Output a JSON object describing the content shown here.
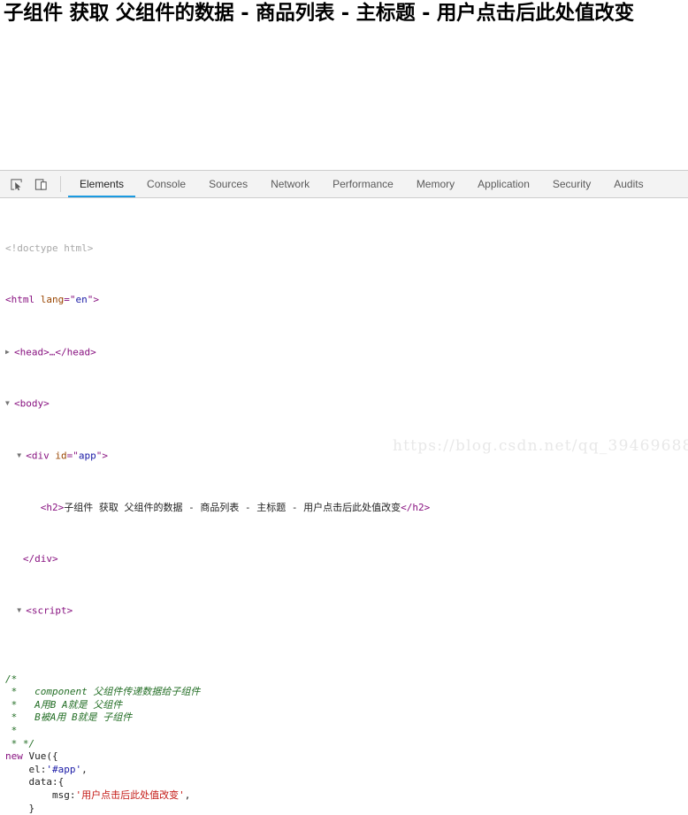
{
  "page": {
    "heading": "子组件 获取 父组件的数据 - 商品列表 - 主标题 - 用户点击后此处值改变"
  },
  "devtools": {
    "toolbar": {
      "inspect_icon": "inspect-element-icon",
      "device_icon": "device-toolbar-icon"
    },
    "tabs": [
      {
        "label": "Elements",
        "active": true
      },
      {
        "label": "Console",
        "active": false
      },
      {
        "label": "Sources",
        "active": false
      },
      {
        "label": "Network",
        "active": false
      },
      {
        "label": "Performance",
        "active": false
      },
      {
        "label": "Memory",
        "active": false
      },
      {
        "label": "Application",
        "active": false
      },
      {
        "label": "Security",
        "active": false
      },
      {
        "label": "Audits",
        "active": false
      }
    ],
    "accent_color": "#1a9ae1",
    "dom": {
      "doctype": "<!doctype html>",
      "html_open_lt": "<",
      "html_tag": "html",
      "html_attr_name": "lang",
      "html_attr_eq": "=\"",
      "html_attr_val": "en",
      "html_attr_close": "\">",
      "head_arrow": "▶",
      "head_line": "<head>…</head>",
      "body_arrow": "▼",
      "body_line": "<body>",
      "div_arrow": "▼",
      "div_open_lt": "<",
      "div_tag": "div",
      "div_attr_name": "id",
      "div_attr_eq": "=\"",
      "div_attr_val": "app",
      "div_attr_close": "\">",
      "h2_open": "<h2>",
      "h2_text": "子组件 获取 父组件的数据 - 商品列表 - 主标题 - 用户点击后此处值改变",
      "h2_close": "</h2>",
      "div_close": "</div>",
      "script_arrow": "▼",
      "script_open": "<script>"
    },
    "source": {
      "comment_lines": [
        "/*",
        " *   component 父组件传递数据给子组件",
        " *   A用B A就是 父组件",
        " *   B被A用 B就是 子组件",
        " *",
        " * */"
      ],
      "kw_new": "new ",
      "vue_call": "Vue({",
      "el_key": "el:",
      "el_val": "'#app'",
      "el_comma": ",",
      "data_key": "data:{",
      "msg_key": "msg:",
      "msg_val": "'用户点击后此处值改变'",
      "msg_comma": ",",
      "closing_brace": "}"
    }
  },
  "watermark": {
    "text": "https://blog.csdn.net/qq_39469688"
  }
}
